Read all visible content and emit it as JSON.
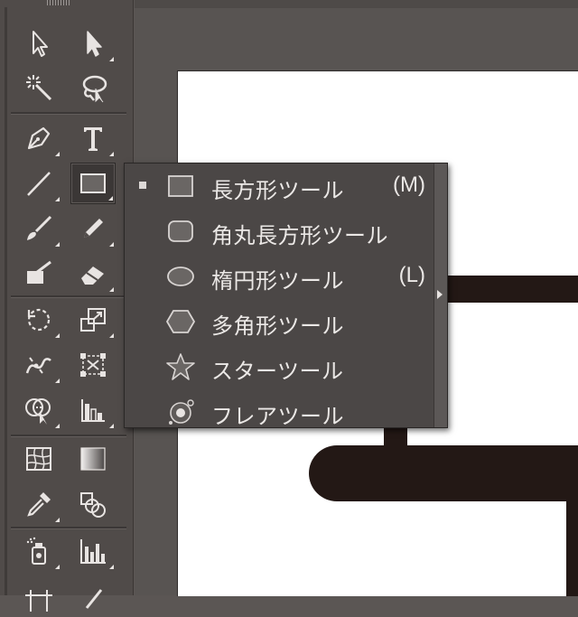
{
  "toolbar": {
    "tools": [
      {
        "name": "selection-tool",
        "icon": "selection-arrow-icon"
      },
      {
        "name": "direct-selection-tool",
        "icon": "direct-selection-arrow-icon"
      },
      {
        "name": "magic-wand-tool",
        "icon": "magic-wand-icon"
      },
      {
        "name": "lasso-tool",
        "icon": "lasso-icon"
      },
      {
        "name": "pen-tool",
        "icon": "pen-nib-icon"
      },
      {
        "name": "type-tool",
        "icon": "type-t-icon",
        "glyph": "T"
      },
      {
        "name": "line-segment-tool",
        "icon": "line-icon"
      },
      {
        "name": "rectangle-tool",
        "icon": "rectangle-icon",
        "active": true
      },
      {
        "name": "paintbrush-tool",
        "icon": "paintbrush-icon"
      },
      {
        "name": "pencil-tool",
        "icon": "pencil-icon"
      },
      {
        "name": "blob-brush-tool",
        "icon": "blob-brush-icon"
      },
      {
        "name": "eraser-tool",
        "icon": "eraser-icon"
      },
      {
        "name": "rotate-tool",
        "icon": "rotate-icon"
      },
      {
        "name": "scale-tool",
        "icon": "scale-icon"
      },
      {
        "name": "width-tool",
        "icon": "width-icon"
      },
      {
        "name": "free-transform-tool",
        "icon": "free-transform-icon"
      },
      {
        "name": "shape-builder-tool",
        "icon": "shape-builder-icon"
      },
      {
        "name": "graph-tool",
        "icon": "column-graph-icon"
      },
      {
        "name": "mesh-tool",
        "icon": "mesh-icon"
      },
      {
        "name": "gradient-tool",
        "icon": "gradient-icon"
      },
      {
        "name": "eyedropper-tool",
        "icon": "eyedropper-icon"
      },
      {
        "name": "blend-tool",
        "icon": "blend-icon"
      },
      {
        "name": "symbol-sprayer-tool",
        "icon": "symbol-sprayer-icon"
      },
      {
        "name": "column-graph-tool",
        "icon": "bar-chart-icon"
      }
    ]
  },
  "flyout": {
    "items": [
      {
        "label": "長方形ツール",
        "shortcut": "(M)",
        "icon": "rectangle-icon",
        "checked": true
      },
      {
        "label": "角丸長方形ツール",
        "shortcut": "",
        "icon": "rounded-rectangle-icon",
        "checked": false
      },
      {
        "label": "楕円形ツール",
        "shortcut": "(L)",
        "icon": "ellipse-icon",
        "checked": false
      },
      {
        "label": "多角形ツール",
        "shortcut": "",
        "icon": "polygon-icon",
        "checked": false
      },
      {
        "label": "スターツール",
        "shortcut": "",
        "icon": "star-icon",
        "checked": false
      },
      {
        "label": "フレアツール",
        "shortcut": "",
        "icon": "flare-icon",
        "checked": false
      }
    ],
    "tearoff_icon": "tearoff-arrow-icon"
  },
  "colors": {
    "toolbar_bg": "#504b49",
    "menu_bg": "#4b4746",
    "menu_text": "#ebe8e6",
    "artboard": "#ffffff",
    "artwork": "#231815"
  }
}
